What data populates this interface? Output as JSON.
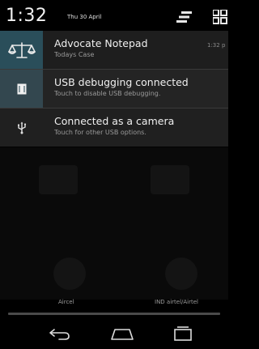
{
  "status_bar": {
    "time": "1:32",
    "date": "Thu 30 April",
    "icons": [
      "clear-all-icon",
      "quick-settings-icon"
    ]
  },
  "notifications": [
    {
      "icon": "scales-of-justice-icon",
      "title": "Advocate Notepad",
      "subtitle": "Todays Case",
      "time": "1:32 p"
    },
    {
      "icon": "usb-debug-icon",
      "title": "USB debugging connected",
      "subtitle": "Touch to disable USB debugging."
    },
    {
      "icon": "usb-icon",
      "title": "Connected as a camera",
      "subtitle": "Touch for other USB options."
    }
  ],
  "carriers": {
    "left": "Aircel",
    "right": "IND airtel/Airtel"
  },
  "nav_bar": {
    "icons": [
      "back-icon",
      "home-icon",
      "recent-apps-icon"
    ]
  },
  "colors": {
    "background": "#000000",
    "notification_bg": "#1e1e1e",
    "icon_box_accent": "#2a4e5a"
  }
}
